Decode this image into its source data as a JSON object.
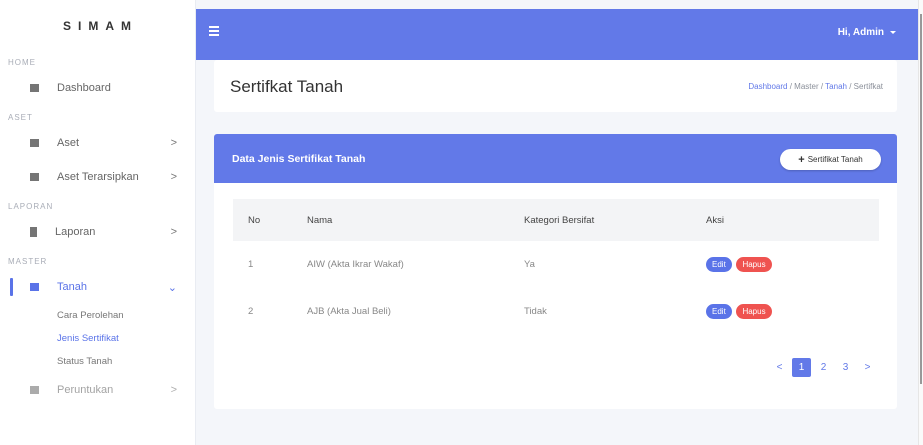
{
  "sidebar": {
    "brand": "SIMAM",
    "sections": {
      "home": "HOME",
      "aset": "ASET",
      "laporan": "LAPORAN",
      "master": "MASTER"
    },
    "items": {
      "dashboard": "Dashboard",
      "aset": "Aset",
      "aset_terarsipkan": "Aset Terarsipkan",
      "laporan": "Laporan",
      "tanah": "Tanah",
      "next": "Peruntukan"
    },
    "sub_items": [
      "Cara Perolehan",
      "Jenis Sertifikat",
      "Status Tanah"
    ],
    "active_sub": "Jenis Sertifikat"
  },
  "topbar": {
    "greeting": "Hi, Admin"
  },
  "page": {
    "title": "Sertifkat Tanah",
    "breadcrumb": [
      "Dashboard",
      "Master",
      "Tanah",
      "Sertifkat"
    ]
  },
  "card": {
    "title": "Data Jenis Sertifikat Tanah",
    "add_button": "Sertifikat Tanah"
  },
  "table": {
    "headers": [
      "No",
      "Nama",
      "Kategori Bersifat",
      "Aksi"
    ],
    "rows": [
      {
        "no": "1",
        "nama": "AIW (Akta Ikrar Wakaf)",
        "kategori": "Ya"
      },
      {
        "no": "2",
        "nama": "AJB (Akta Jual Beli)",
        "kategori": "Tidak"
      }
    ],
    "edit_label": "Edit",
    "delete_label": "Hapus"
  },
  "pagination": {
    "prev": "<",
    "pages": [
      "1",
      "2",
      "3"
    ],
    "current": "1",
    "next": ">"
  },
  "colors": {
    "primary": "#6279e8",
    "danger": "#ef5350"
  },
  "icons": [
    "menu-icon",
    "grid-icon",
    "folder-icon",
    "archive-icon",
    "file-icon",
    "flag-icon",
    "chevron-right-icon",
    "chevron-down-icon",
    "caret-down-icon",
    "plus-icon"
  ]
}
